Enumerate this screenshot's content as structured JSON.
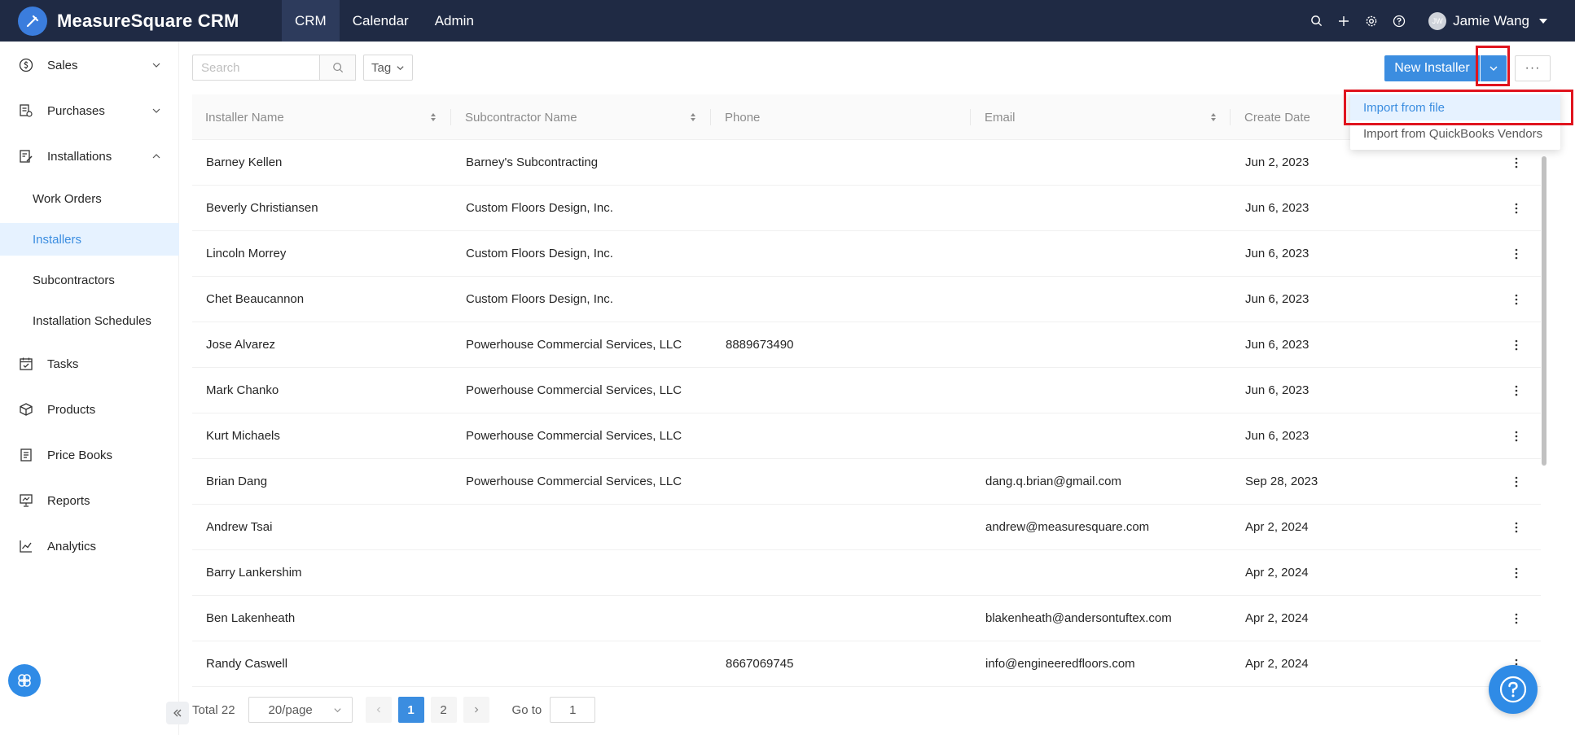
{
  "app": {
    "title": "MeasureSquare CRM"
  },
  "topnav": [
    {
      "label": "CRM",
      "active": true
    },
    {
      "label": "Calendar",
      "active": false
    },
    {
      "label": "Admin",
      "active": false
    }
  ],
  "user": {
    "initials": "JW",
    "name": "Jamie Wang"
  },
  "sidebar": {
    "items": [
      {
        "label": "Sales",
        "icon": "dollar-icon",
        "chevron": "down"
      },
      {
        "label": "Purchases",
        "icon": "purchases-icon",
        "chevron": "down"
      },
      {
        "label": "Installations",
        "icon": "installations-icon",
        "chevron": "up"
      },
      {
        "label": "Tasks",
        "icon": "tasks-icon"
      },
      {
        "label": "Products",
        "icon": "box-icon"
      },
      {
        "label": "Price Books",
        "icon": "price-book-icon"
      },
      {
        "label": "Reports",
        "icon": "reports-icon"
      },
      {
        "label": "Analytics",
        "icon": "analytics-icon"
      }
    ],
    "subitems": [
      {
        "label": "Work Orders",
        "active": false
      },
      {
        "label": "Installers",
        "active": true
      },
      {
        "label": "Subcontractors",
        "active": false
      },
      {
        "label": "Installation Schedules",
        "active": false
      }
    ]
  },
  "toolbar": {
    "search_placeholder": "Search",
    "tag_label": "Tag",
    "new_button": "New Installer",
    "more_label": "···"
  },
  "dropdown": {
    "items": [
      {
        "label": "Import from file",
        "active": true
      },
      {
        "label": "Import from QuickBooks Vendors",
        "active": false
      }
    ]
  },
  "table": {
    "columns": [
      "Installer Name",
      "Subcontractor Name",
      "Phone",
      "Email",
      "Create Date"
    ],
    "rows": [
      [
        "Barney Kellen",
        "Barney's Subcontracting",
        "",
        "",
        "Jun 2, 2023"
      ],
      [
        "Beverly Christiansen",
        "Custom Floors Design, Inc.",
        "",
        "",
        "Jun 6, 2023"
      ],
      [
        "Lincoln Morrey",
        "Custom Floors Design, Inc.",
        "",
        "",
        "Jun 6, 2023"
      ],
      [
        "Chet Beaucannon",
        "Custom Floors Design, Inc.",
        "",
        "",
        "Jun 6, 2023"
      ],
      [
        "Jose Alvarez",
        "Powerhouse Commercial Services, LLC",
        "8889673490",
        "",
        "Jun 6, 2023"
      ],
      [
        "Mark Chanko",
        "Powerhouse Commercial Services, LLC",
        "",
        "",
        "Jun 6, 2023"
      ],
      [
        "Kurt Michaels",
        "Powerhouse Commercial Services, LLC",
        "",
        "",
        "Jun 6, 2023"
      ],
      [
        "Brian Dang",
        "Powerhouse Commercial Services, LLC",
        "",
        "dang.q.brian@gmail.com",
        "Sep 28, 2023"
      ],
      [
        "Andrew Tsai",
        "",
        "",
        "andrew@measuresquare.com",
        "Apr 2, 2024"
      ],
      [
        "Barry Lankershim",
        "",
        "",
        "",
        "Apr 2, 2024"
      ],
      [
        "Ben Lakenheath",
        "",
        "",
        "blakenheath@andersontuftex.com",
        "Apr 2, 2024"
      ],
      [
        "Randy Caswell",
        "",
        "8667069745",
        "info@engineeredfloors.com",
        "Apr 2, 2024"
      ]
    ]
  },
  "pagination": {
    "total": "Total 22",
    "page_size": "20/page",
    "pages": [
      "1",
      "2"
    ],
    "current": "1",
    "goto_label": "Go to",
    "goto_value": "1"
  },
  "colors": {
    "topbar": "#1f2a44",
    "accent": "#3b8de0",
    "highlight_outline": "#e0141e"
  }
}
